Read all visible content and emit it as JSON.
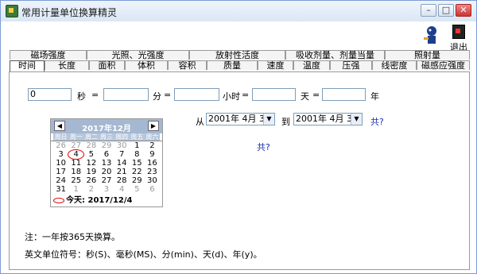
{
  "window": {
    "title": "常用计量单位换算精灵",
    "minimize": "–",
    "restore": "□",
    "close": "✕",
    "exit_label": "退出"
  },
  "tabs_row1": [
    "磁场强度",
    "光照、光强度",
    "放射性活度",
    "吸收剂量、剂量当量",
    "照射量"
  ],
  "tabs_row2": [
    "时间",
    "长度",
    "面积",
    "体积",
    "容积",
    "质量",
    "速度",
    "温度",
    "压强",
    "线密度",
    "磁感应强度"
  ],
  "active_tab": "时间",
  "converter": {
    "seconds_value": "0",
    "seconds_unit": "秒",
    "minutes_unit": "分",
    "hours_unit": "小时",
    "days_unit": "天",
    "years_unit": "年",
    "eq": "="
  },
  "date_range": {
    "from_label": "从",
    "from_value": "2001年 4月 3日",
    "to_label": "到",
    "to_value": "2001年 4月 3日",
    "total_label": "共?",
    "result_label": "共?"
  },
  "calendar": {
    "title": "2017年12月",
    "prev": "◀",
    "next": "▶",
    "weekdays": [
      "周日",
      "周一",
      "周二",
      "周三",
      "周四",
      "周五",
      "周六"
    ],
    "weeks": [
      [
        "26",
        "27",
        "28",
        "29",
        "30",
        "1",
        "2"
      ],
      [
        "3",
        "4",
        "5",
        "6",
        "7",
        "8",
        "9"
      ],
      [
        "10",
        "11",
        "12",
        "13",
        "14",
        "15",
        "16"
      ],
      [
        "17",
        "18",
        "19",
        "20",
        "21",
        "22",
        "23"
      ],
      [
        "24",
        "25",
        "26",
        "27",
        "28",
        "29",
        "30"
      ],
      [
        "31",
        "1",
        "2",
        "3",
        "4",
        "5",
        "6"
      ]
    ],
    "today_label": "今天: 2017/12/4"
  },
  "notes": {
    "note1": "注：一年按365天换算。",
    "note2": "英文单位符号：秒(S)、毫秒(MS)、分(min)、天(d)、年(y)。"
  }
}
